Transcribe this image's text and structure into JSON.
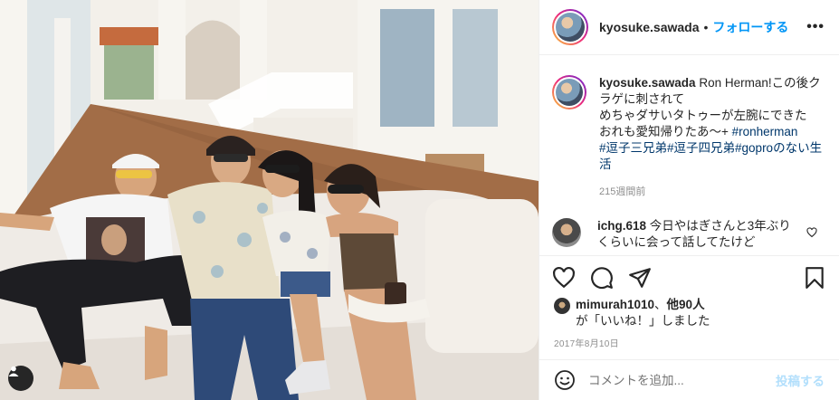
{
  "header": {
    "username": "kyosuke.sawada",
    "separator": "•",
    "follow_label": "フォローする",
    "more_label": "•••"
  },
  "caption": {
    "username": "kyosuke.sawada",
    "text_line1": "Ron Herman!この後クラゲに刺されて",
    "text_line2": "めちゃダサいタトゥーが左腕にできた",
    "text_line3": "おれも愛知帰りたあ〜+ ",
    "hashtag1": "#ronherman",
    "hashtag2": "#逗子三兄弟",
    "hashtag3": "#逗子四兄弟",
    "hashtag4": "#goproのない生活",
    "time": "215週間前"
  },
  "comment": {
    "username": "ichg.618",
    "text": "今日やはぎさんと3年ぶりくらいに会って話してたけど"
  },
  "likes": {
    "username": "mimurah1010",
    "separator": "、",
    "others": "他90人",
    "suffix": "が「いいね！」しました"
  },
  "post_date": "2017年8月10日",
  "add_comment": {
    "placeholder": "コメントを追加...",
    "post_label": "投稿する"
  },
  "icons": {
    "like": "heart-icon",
    "comment": "speech-bubble-icon",
    "share": "paper-plane-icon",
    "save": "bookmark-icon",
    "emoji": "smiley-icon",
    "user_tag": "person-icon"
  },
  "colors": {
    "follow_blue": "#0095f6",
    "hashtag_blue": "#00376b",
    "post_disabled": "#b2dffc",
    "meta_gray": "#8e8e8e"
  }
}
